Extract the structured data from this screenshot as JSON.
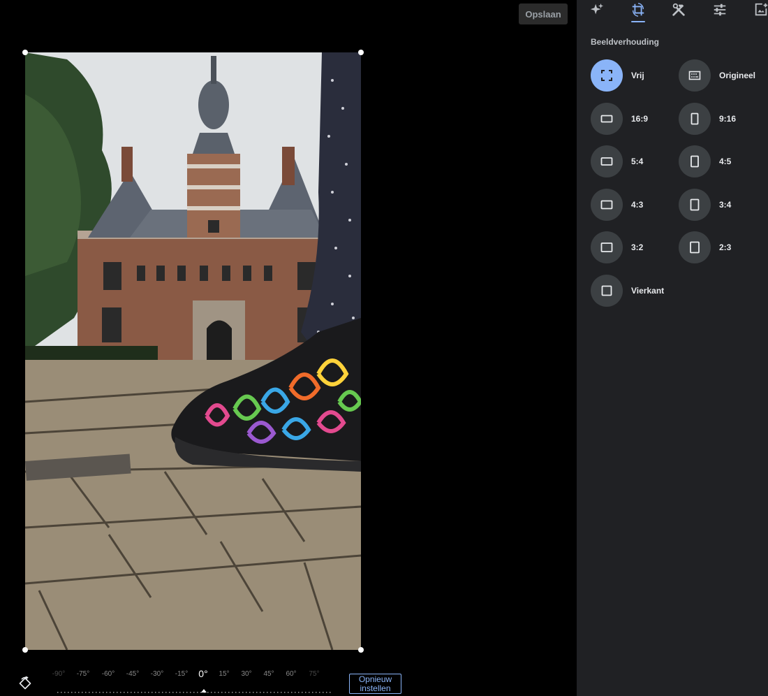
{
  "header": {
    "save_label": "Opslaan"
  },
  "toolbar": {
    "tools": [
      {
        "icon": "auto-enhance-sparkle-icon"
      },
      {
        "icon": "crop-rotate-icon",
        "active": true
      },
      {
        "icon": "tools-hammer-wrench-icon"
      },
      {
        "icon": "adjust-sliders-icon"
      },
      {
        "icon": "add-frame-icon"
      }
    ],
    "accent_color": "#8ab4f8"
  },
  "aspect": {
    "title": "Beeldverhouding",
    "options": [
      {
        "label": "Vrij",
        "icon": "free-crop-icon",
        "selected": true
      },
      {
        "label": "Origineel",
        "icon": "original-ratio-icon"
      },
      {
        "label": "16:9",
        "icon": "landscape-ratio-icon"
      },
      {
        "label": "9:16",
        "icon": "portrait-ratio-icon"
      },
      {
        "label": "5:4",
        "icon": "landscape-ratio-icon"
      },
      {
        "label": "4:5",
        "icon": "portrait-ratio-icon"
      },
      {
        "label": "4:3",
        "icon": "landscape-ratio-icon"
      },
      {
        "label": "3:4",
        "icon": "portrait-ratio-icon"
      },
      {
        "label": "3:2",
        "icon": "landscape-ratio-icon"
      },
      {
        "label": "2:3",
        "icon": "portrait-ratio-icon"
      },
      {
        "label": "Vierkant",
        "icon": "square-ratio-icon"
      }
    ]
  },
  "rotation": {
    "angles": [
      "-90°",
      "-75°",
      "-60°",
      "-45°",
      "-30°",
      "-15°",
      "0°",
      "15°",
      "30°",
      "45°",
      "60°",
      "75°"
    ],
    "current": "0°",
    "reset_label_line1": "Opnieuw",
    "reset_label_line2": "instellen"
  },
  "photo": {
    "subject": "sneaker-in-front-of-castle-photo"
  }
}
